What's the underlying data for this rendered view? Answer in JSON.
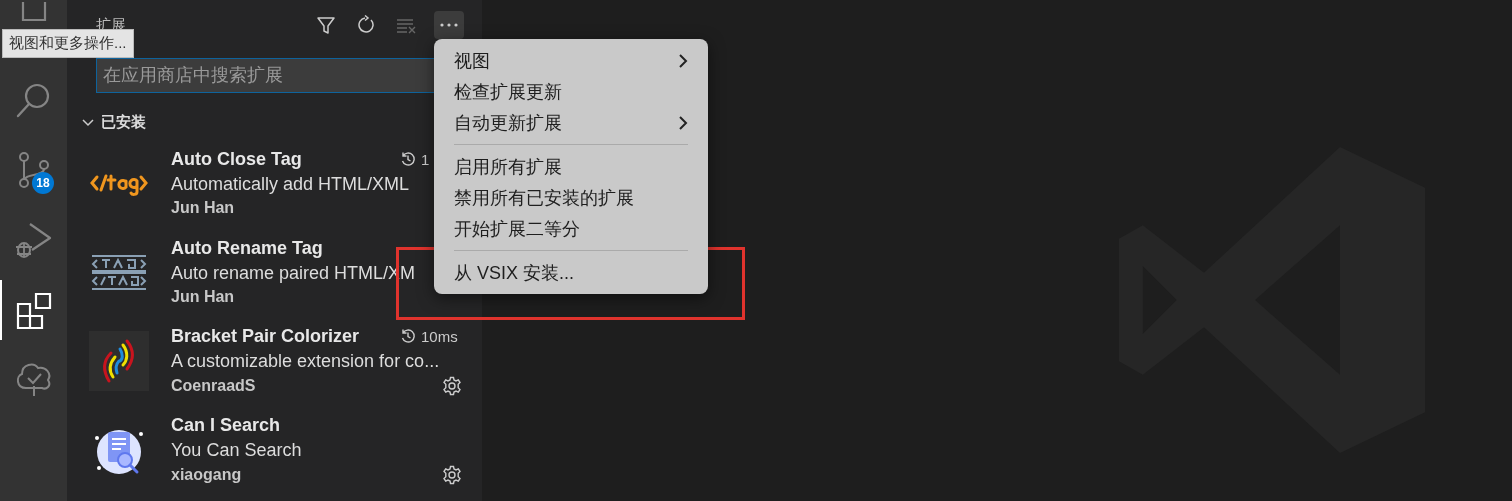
{
  "activity_bar": {
    "items": [
      {
        "kind": "files",
        "selected": false
      },
      {
        "kind": "search",
        "selected": false
      },
      {
        "kind": "source-control",
        "selected": false,
        "badge": "18"
      },
      {
        "kind": "run",
        "selected": false
      },
      {
        "kind": "extensions",
        "selected": true
      },
      {
        "kind": "tree",
        "selected": false
      }
    ]
  },
  "tooltip": "视图和更多操作...",
  "sidebar": {
    "title": "扩展",
    "search": {
      "placeholder": "在应用商店中搜索扩展"
    },
    "section": {
      "title": "已安装",
      "expanded": true
    },
    "extensions": [
      {
        "kind": "tag",
        "name": "Auto Close Tag",
        "description": "Automatically add HTML/XML",
        "author": "Jun Han",
        "time": "1",
        "settings": false
      },
      {
        "kind": "rename",
        "name": "Auto Rename Tag",
        "description": "Auto rename paired HTML/XM",
        "author": "Jun Han",
        "settings": false
      },
      {
        "kind": "brackets",
        "name": "Bracket Pair Colorizer",
        "description": "A customizable extension for co...",
        "author": "CoenraadS",
        "time": "10ms",
        "settings": true
      },
      {
        "kind": "search-doc",
        "name": "Can I Search",
        "description": "You Can Search",
        "author": "xiaogang",
        "settings": true
      }
    ]
  },
  "menu": {
    "groups": [
      [
        {
          "label": "视图",
          "submenu": true
        },
        {
          "label": "检查扩展更新",
          "submenu": false
        },
        {
          "label": "自动更新扩展",
          "submenu": true
        }
      ],
      [
        {
          "label": "启用所有扩展",
          "submenu": false
        },
        {
          "label": "禁用所有已安装的扩展",
          "submenu": false
        },
        {
          "label": "开始扩展二等分",
          "submenu": false
        }
      ],
      [
        {
          "label": "从 VSIX 安装...",
          "submenu": false
        }
      ]
    ]
  }
}
